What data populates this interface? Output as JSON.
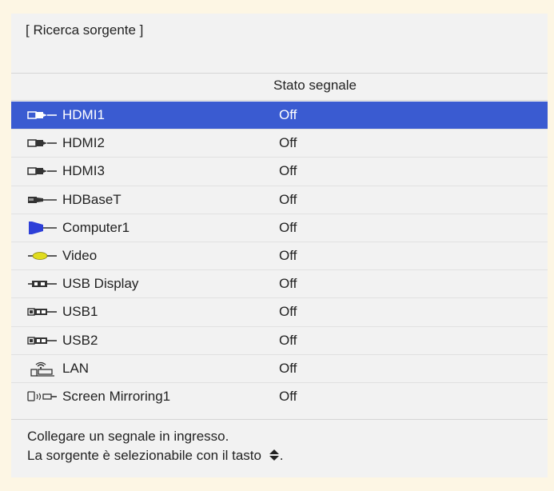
{
  "title": "[ Ricerca sorgente ]",
  "column_header": "Stato segnale",
  "sources": [
    {
      "label": "HDMI1",
      "status": "Off",
      "icon": "hdmi-icon",
      "selected": true
    },
    {
      "label": "HDMI2",
      "status": "Off",
      "icon": "hdmi-icon",
      "selected": false
    },
    {
      "label": "HDMI3",
      "status": "Off",
      "icon": "hdmi-icon",
      "selected": false
    },
    {
      "label": "HDBaseT",
      "status": "Off",
      "icon": "hdbaset-icon",
      "selected": false
    },
    {
      "label": "Computer1",
      "status": "Off",
      "icon": "vga-icon",
      "selected": false
    },
    {
      "label": "Video",
      "status": "Off",
      "icon": "video-rca-icon",
      "selected": false
    },
    {
      "label": "USB Display",
      "status": "Off",
      "icon": "usb-display-icon",
      "selected": false
    },
    {
      "label": "USB1",
      "status": "Off",
      "icon": "usb-icon",
      "selected": false
    },
    {
      "label": "USB2",
      "status": "Off",
      "icon": "usb-icon",
      "selected": false
    },
    {
      "label": "LAN",
      "status": "Off",
      "icon": "lan-icon",
      "selected": false
    },
    {
      "label": "Screen Mirroring1",
      "status": "Off",
      "icon": "screen-mirroring-icon",
      "selected": false
    }
  ],
  "footer": {
    "line1": "Collegare un segnale in ingresso.",
    "line2": "La sorgente è selezionabile con il tasto",
    "line2_end": ".",
    "key_icon": "up-down-arrow-icon"
  },
  "colors": {
    "background": "#fdf6e4",
    "panel": "#f2f2f2",
    "selection": "#3a5bd1",
    "vga_connector": "#2d3fd8",
    "video_connector": "#e0dc1e"
  }
}
